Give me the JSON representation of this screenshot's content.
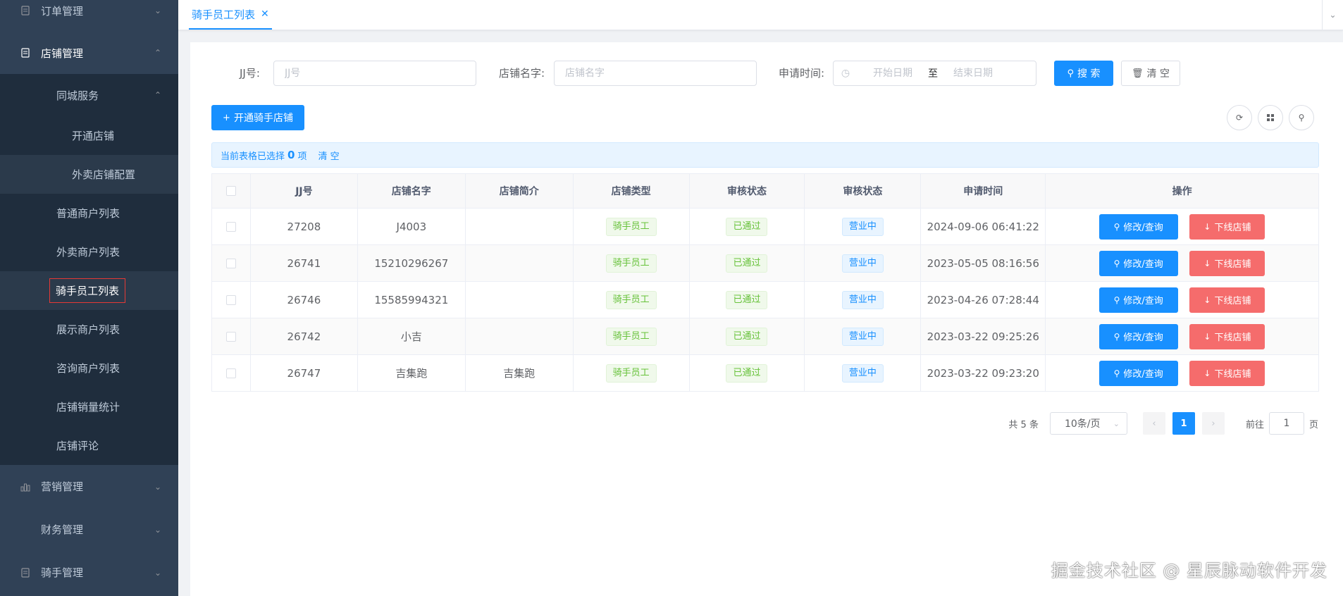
{
  "sidebar": {
    "order_mgmt": "订单管理",
    "store_mgmt": "店铺管理",
    "city_service": "同城服务",
    "open_store": "开通店铺",
    "takeout_config": "外卖店铺配置",
    "normal_merchants": "普通商户列表",
    "takeout_merchants": "外卖商户列表",
    "rider_staff_list": "骑手员工列表",
    "display_merchants": "展示商户列表",
    "consult_merchants": "咨询商户列表",
    "store_sales_stats": "店铺销量统计",
    "store_reviews": "店铺评论",
    "marketing_mgmt": "营销管理",
    "finance_mgmt": "财务管理",
    "rider_mgmt": "骑手管理"
  },
  "tab": {
    "label": "骑手员工列表"
  },
  "filters": {
    "jj_label": "JJ号:",
    "jj_placeholder": "JJ号",
    "store_label": "店铺名字:",
    "store_placeholder": "店铺名字",
    "date_label": "申请时间:",
    "start_placeholder": "开始日期",
    "end_placeholder": "结束日期",
    "date_sep": "至",
    "search_btn": "搜 索",
    "clear_btn": "清 空"
  },
  "toolbar": {
    "open_rider_store": "开通骑手店铺"
  },
  "alert": {
    "prefix": "当前表格已选择",
    "count": "0",
    "unit": "项",
    "clear": "清 空"
  },
  "table": {
    "headers": [
      "JJ号",
      "店铺名字",
      "店铺简介",
      "店铺类型",
      "审核状态",
      "审核状态",
      "申请时间",
      "操作"
    ],
    "rows": [
      {
        "jj": "27208",
        "name": "J4003",
        "intro": "",
        "type": "骑手员工",
        "audit": "已通过",
        "status": "营业中",
        "time": "2024-09-06 06:41:22"
      },
      {
        "jj": "26741",
        "name": "15210296267",
        "intro": "",
        "type": "骑手员工",
        "audit": "已通过",
        "status": "营业中",
        "time": "2023-05-05 08:16:56"
      },
      {
        "jj": "26746",
        "name": "15585994321",
        "intro": "",
        "type": "骑手员工",
        "audit": "已通过",
        "status": "营业中",
        "time": "2023-04-26 07:28:44"
      },
      {
        "jj": "26742",
        "name": "小吉",
        "intro": "",
        "type": "骑手员工",
        "audit": "已通过",
        "status": "营业中",
        "time": "2023-03-22 09:25:26"
      },
      {
        "jj": "26747",
        "name": "吉集跑",
        "intro": "吉集跑",
        "type": "骑手员工",
        "audit": "已通过",
        "status": "营业中",
        "time": "2023-03-22 09:23:20"
      }
    ],
    "edit_label": "修改/查询",
    "offline_label": "下线店铺"
  },
  "pager": {
    "total": "共 5 条",
    "size": "10条/页",
    "current": "1",
    "goto": "前往",
    "page_unit": "页",
    "jump_value": "1"
  },
  "watermark": "掘金技术社区 @ 星辰脉动软件开发",
  "colors": {
    "sidebar_bg": "#304156",
    "primary": "#1890ff",
    "danger": "#f56c6c",
    "success": "#67c23a"
  }
}
